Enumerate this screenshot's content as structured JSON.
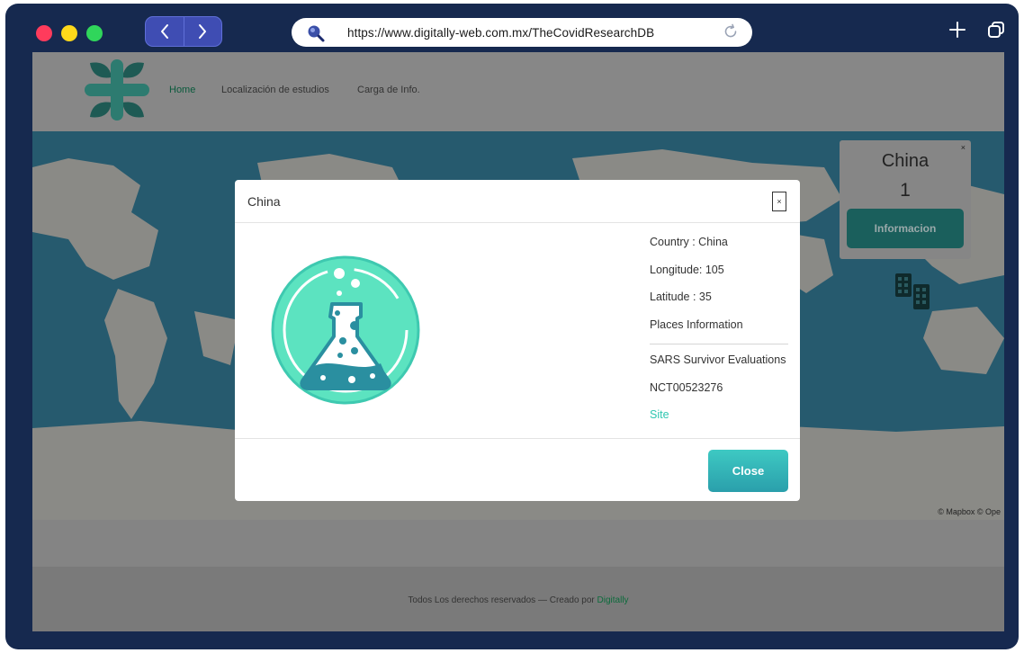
{
  "browser": {
    "url": "https://www.digitally-web.com.mx/TheCovidResearchDB",
    "icons": [
      "chevron-left-icon",
      "chevron-right-icon",
      "search-icon",
      "reload-icon",
      "plus-icon",
      "tabs-icon"
    ],
    "traffic_light_colors": [
      "#ff3b5c",
      "#ffd91a",
      "#30d65b"
    ]
  },
  "site": {
    "nav": [
      {
        "label": "Home"
      },
      {
        "label": "Localización de estudios"
      },
      {
        "label": "Carga de Info."
      }
    ],
    "attribution": "© Mapbox © Ope",
    "footer": {
      "text": "Todos Los derechos reservados — Creado por ",
      "link": "Digitally"
    }
  },
  "map_popup": {
    "close": "×",
    "country": "China",
    "count": "1",
    "button": "Informacion"
  },
  "modal": {
    "title": "China",
    "close_x": "×",
    "details": {
      "country": "Country : China",
      "longitude": "Longitude: 105",
      "latitude": "Latitude : 35",
      "places": "Places Information",
      "study": "SARS Survivor Evaluations",
      "nct": "NCT00523276",
      "site_link": "Site"
    },
    "close_button": "Close"
  },
  "colors": {
    "frame": "#16294f",
    "accent": "#2fc6b0",
    "ocean_dimmed": "#265a6e"
  }
}
